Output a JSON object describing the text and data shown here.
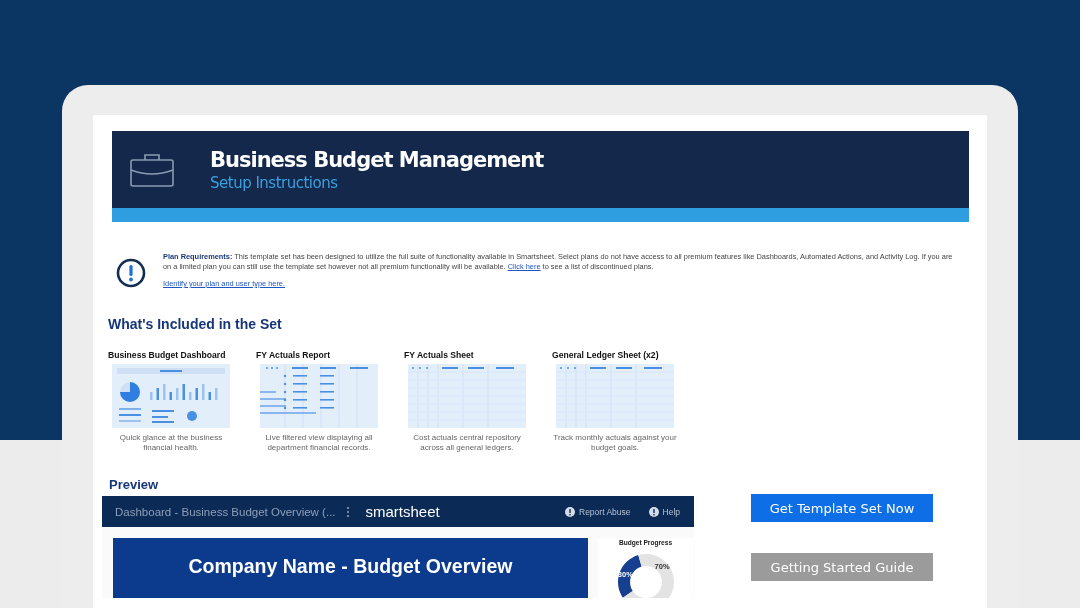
{
  "header": {
    "title": "Business Budget Management",
    "subtitle": "Setup Instructions"
  },
  "notice": {
    "text": "**Plan Requirements:** This template set has been designed to utilize the full suite of functionality available in Smartsheet. Select plans do not have access to all premium features like Dashboards, Automated Actions, and Activity Log. If you are on a limited plan you can still use the template set however not all premium functionality will be available.",
    "link": "Click here",
    "after": "to see a list of discontinued plans.",
    "second_link": "Identify your plan and user type here."
  },
  "included": {
    "heading": "What's Included in the Set",
    "items": [
      {
        "title": "Business Budget Dashboard",
        "kind": "dashboard",
        "description": "Quick glance at the business financial health."
      },
      {
        "title": "FY Actuals Report",
        "kind": "report",
        "description": "Live filtered view displaying all department financial records."
      },
      {
        "title": "FY Actuals Sheet",
        "kind": "sheet",
        "description": "Cost actuals central repository across all general ledgers."
      },
      {
        "title": "General Ledger Sheet (x2)",
        "kind": "sheet",
        "description": "Track monthly actuals against your budget goals."
      }
    ]
  },
  "preview": {
    "heading": "Preview",
    "bar_title": "Dashboard - Business Budget Overview (...",
    "logo": "smartsheet",
    "actions": [
      "Report Abuse",
      "Help"
    ],
    "banner": "Company Name - Budget Overview",
    "panel_title": "Budget Progress",
    "chart_data": {
      "type": "donut",
      "values": [
        30,
        70
      ],
      "value_labels": [
        "30%",
        "70%"
      ]
    }
  },
  "buttons": [
    {
      "label": "Get Template Set Now",
      "kind": "primary"
    },
    {
      "label": "Getting Started Guide",
      "kind": "secondary"
    }
  ]
}
